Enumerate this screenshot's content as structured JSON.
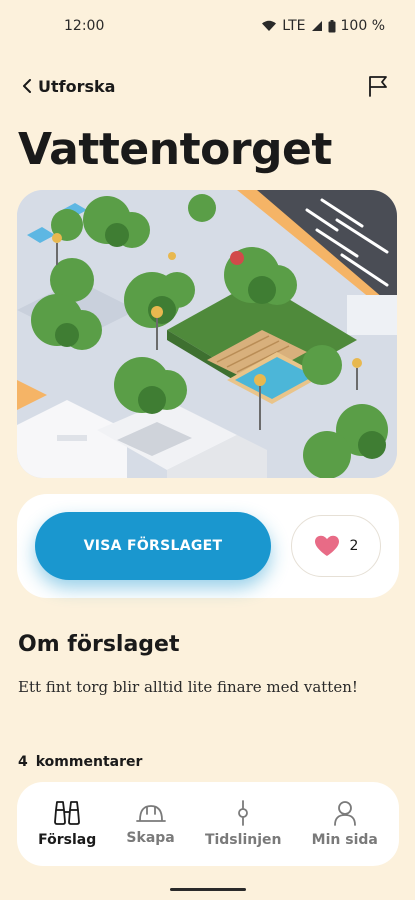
{
  "status_bar": {
    "time": "12:00",
    "network": "LTE",
    "battery": "100 %"
  },
  "nav": {
    "back_label": "Utforska",
    "back_icon": "chevron-left-icon",
    "flag_icon": "flag-icon"
  },
  "page": {
    "title": "Vattentorget"
  },
  "hero_image": {
    "alt": "isometric-town-square-illustration"
  },
  "actions": {
    "primary_label": "VISA FÖRSLAGET",
    "like_count": "2",
    "like_icon": "heart-icon"
  },
  "about": {
    "title": "Om förslaget",
    "description": "Ett fint torg blir alltid lite finare med vatten!"
  },
  "comments": {
    "count": "4",
    "label": "kommentarer"
  },
  "bottom_nav": {
    "items": [
      {
        "label": "Förslag",
        "icon": "binoculars-icon",
        "active": true
      },
      {
        "label": "Skapa",
        "icon": "helmet-icon",
        "active": false
      },
      {
        "label": "Tidslinjen",
        "icon": "timeline-icon",
        "active": false
      },
      {
        "label": "Min sida",
        "icon": "person-icon",
        "active": false
      }
    ]
  },
  "colors": {
    "background": "#fcf1dc",
    "accent": "#1a97cf",
    "heart": "#e86b86",
    "surface": "#ffffff"
  }
}
